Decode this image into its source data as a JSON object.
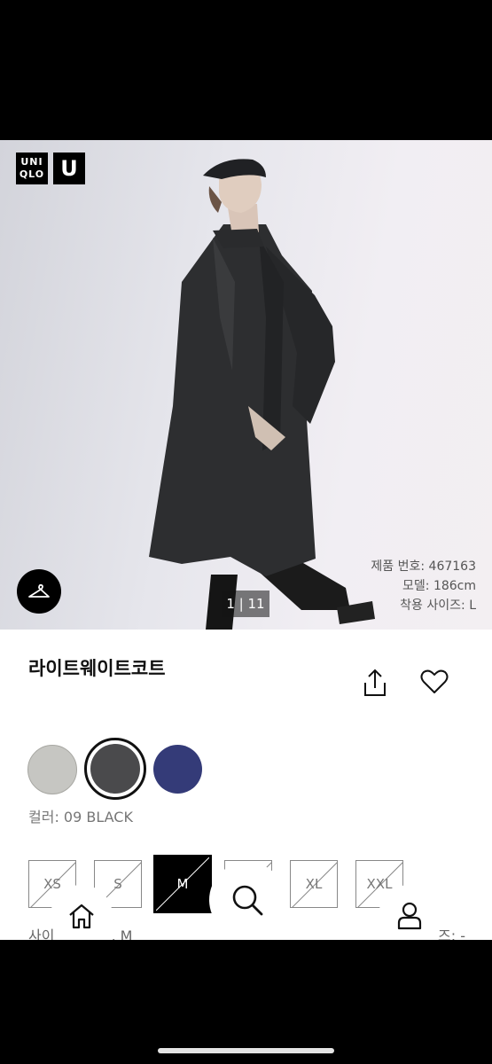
{
  "brand": {
    "logo_top": "UNI",
    "logo_bottom": "QLO",
    "logo_u": "U"
  },
  "hero": {
    "pager": "1 | 11",
    "model_info": [
      "제품 번호: 467163",
      "모델: 186cm",
      "착용 사이즈: L"
    ]
  },
  "product": {
    "title": "라이트웨이트코트"
  },
  "colors": {
    "swatches": [
      {
        "name": "gray",
        "hex": "#c6c6c2"
      },
      {
        "name": "black",
        "hex": "#4a4a4c",
        "selected": true
      },
      {
        "name": "navy",
        "hex": "#343b78"
      }
    ],
    "label": "컬러: 09 BLACK"
  },
  "sizes": {
    "options": [
      "XS",
      "S",
      "M",
      "L",
      "XL",
      "XXL"
    ],
    "selected": "M",
    "label_prefix": "사이",
    "label_value": ", M",
    "guide_partial": "즈: -"
  },
  "icons": [
    "hanger-icon",
    "share-icon",
    "heart-icon",
    "home-icon",
    "search-icon",
    "user-icon"
  ]
}
